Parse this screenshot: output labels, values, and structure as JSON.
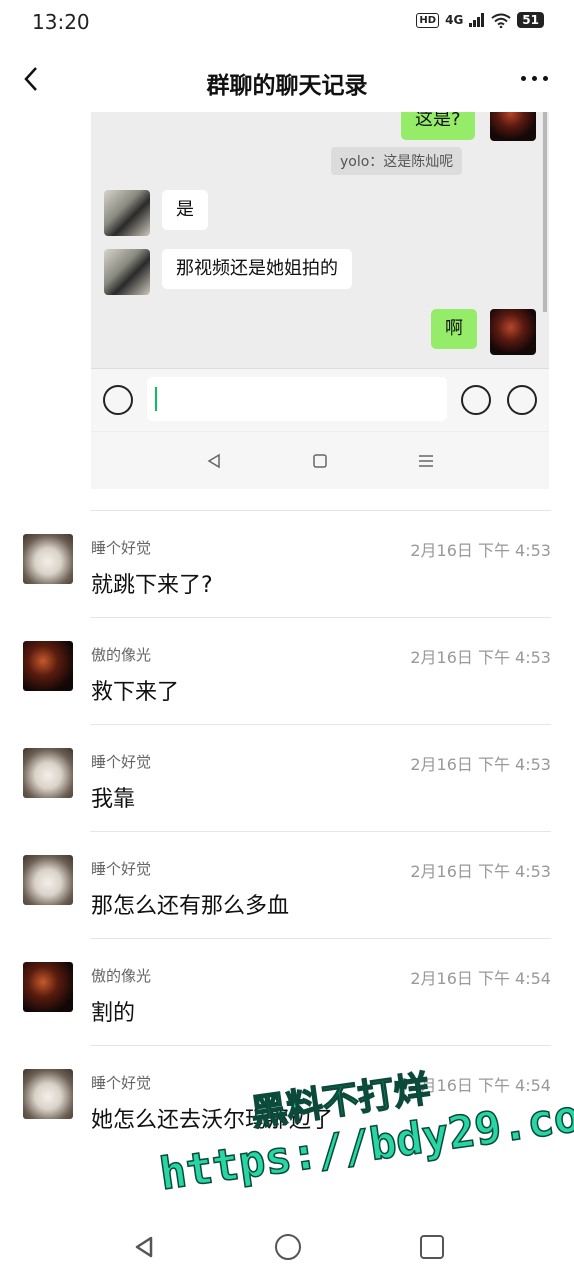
{
  "status_bar": {
    "time": "13:20",
    "hd": "HD",
    "network": "4G",
    "battery": "51"
  },
  "header": {
    "title": "群聊的聊天记录"
  },
  "screenshot": {
    "messages": [
      {
        "side": "right",
        "text": "这是?"
      },
      {
        "side": "system",
        "text": "yolo：这是陈灿呢"
      },
      {
        "side": "left",
        "text": "是"
      },
      {
        "side": "left",
        "text": "那视频还是她姐拍的"
      },
      {
        "side": "right",
        "text": "啊"
      }
    ]
  },
  "records": [
    {
      "name": "睡个好觉",
      "time": "2月16日 下午 4:53",
      "message": "就跳下来了?",
      "avatar": "cat"
    },
    {
      "name": "傲的像光",
      "time": "2月16日 下午 4:53",
      "message": "救下来了",
      "avatar": "dark"
    },
    {
      "name": "睡个好觉",
      "time": "2月16日 下午 4:53",
      "message": "我靠",
      "avatar": "cat"
    },
    {
      "name": "睡个好觉",
      "time": "2月16日 下午 4:53",
      "message": "那怎么还有那么多血",
      "avatar": "cat"
    },
    {
      "name": "傲的像光",
      "time": "2月16日 下午 4:54",
      "message": "割的",
      "avatar": "dark"
    },
    {
      "name": "睡个好觉",
      "time": "2月16日 下午 4:54",
      "message": "她怎么还去沃尔玛那边了",
      "avatar": "cat"
    }
  ],
  "watermark": {
    "line1": "黑料不打烊",
    "line2": "https://bdy29.co"
  },
  "colors": {
    "bubble_right": "#95ec69",
    "accent": "#07c160",
    "watermark": "#27d6a4"
  }
}
